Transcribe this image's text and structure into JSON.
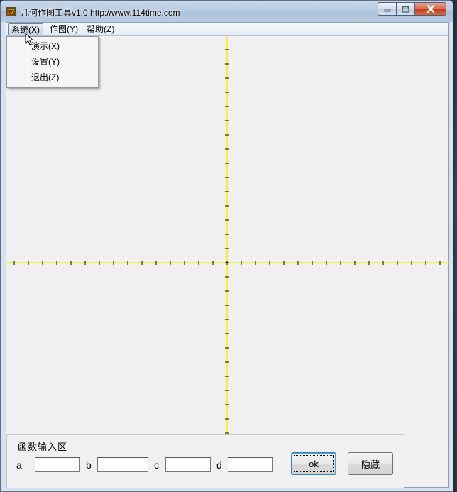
{
  "window": {
    "title": "几何作图工具v1.0  http://www.114time.com",
    "icon": "app-logo-icon",
    "controls": {
      "minimize": "minimize-icon",
      "maximize": "maximize-icon",
      "close": "close-icon"
    }
  },
  "menubar": {
    "items": [
      {
        "label": "系统(X)",
        "active": true
      },
      {
        "label": "作图(Y)",
        "active": false
      },
      {
        "label": "帮助(Z)",
        "active": false
      }
    ],
    "dropdown": [
      {
        "label": "演示(X)"
      },
      {
        "label": "设置(Y)"
      },
      {
        "label": "退出(Z)"
      }
    ]
  },
  "canvas": {
    "axis_color": "#ffee00",
    "tick_color": "#000000",
    "tick_count_x": 31,
    "tick_count_y": 28
  },
  "input_panel": {
    "title": "函数输入区",
    "fields": [
      {
        "label": "a",
        "value": ""
      },
      {
        "label": "b",
        "value": ""
      },
      {
        "label": "c",
        "value": ""
      },
      {
        "label": "d",
        "value": ""
      }
    ],
    "ok_label": "ok",
    "hide_label": "隐藏"
  }
}
